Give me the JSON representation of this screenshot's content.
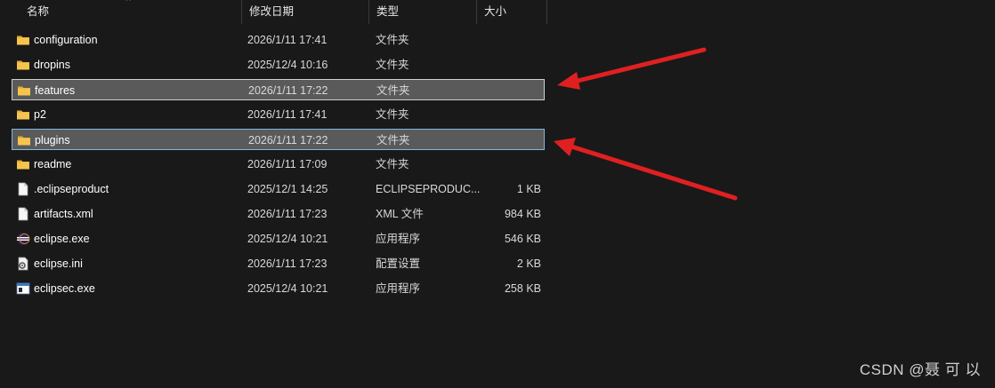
{
  "columns": {
    "name": "名称",
    "date": "修改日期",
    "type": "类型",
    "size": "大小"
  },
  "rows": [
    {
      "name": "configuration",
      "date": "2026/1/11 17:41",
      "type": "文件夹",
      "size": "",
      "icon": "folder-icon",
      "state": "normal"
    },
    {
      "name": "dropins",
      "date": "2025/12/4 10:16",
      "type": "文件夹",
      "size": "",
      "icon": "folder-icon",
      "state": "normal"
    },
    {
      "name": "features",
      "date": "2026/1/11 17:22",
      "type": "文件夹",
      "size": "",
      "icon": "folder-icon",
      "state": "selected"
    },
    {
      "name": "p2",
      "date": "2026/1/11 17:41",
      "type": "文件夹",
      "size": "",
      "icon": "folder-icon",
      "state": "normal"
    },
    {
      "name": "plugins",
      "date": "2026/1/11 17:22",
      "type": "文件夹",
      "size": "",
      "icon": "folder-icon",
      "state": "selected-focus"
    },
    {
      "name": "readme",
      "date": "2026/1/11 17:09",
      "type": "文件夹",
      "size": "",
      "icon": "folder-icon",
      "state": "normal"
    },
    {
      "name": ".eclipseproduct",
      "date": "2025/12/1 14:25",
      "type": "ECLIPSEPRODUC...",
      "size": "1 KB",
      "icon": "file-icon",
      "state": "normal"
    },
    {
      "name": "artifacts.xml",
      "date": "2026/1/11 17:23",
      "type": "XML 文件",
      "size": "984 KB",
      "icon": "file-icon",
      "state": "normal"
    },
    {
      "name": "eclipse.exe",
      "date": "2025/12/4 10:21",
      "type": "应用程序",
      "size": "546 KB",
      "icon": "eclipse-app-icon",
      "state": "normal"
    },
    {
      "name": "eclipse.ini",
      "date": "2026/1/11 17:23",
      "type": "配置设置",
      "size": "2 KB",
      "icon": "config-file-icon",
      "state": "normal"
    },
    {
      "name": "eclipsec.exe",
      "date": "2025/12/4 10:21",
      "type": "应用程序",
      "size": "258 KB",
      "icon": "console-app-icon",
      "state": "normal"
    }
  ],
  "watermark": "CSDN @聂 可 以",
  "colors": {
    "background": "#191919",
    "selection": "#5a5a5a",
    "focus_border": "#7fb8e0",
    "folder": "#f4c44e",
    "arrow": "#e02020"
  }
}
